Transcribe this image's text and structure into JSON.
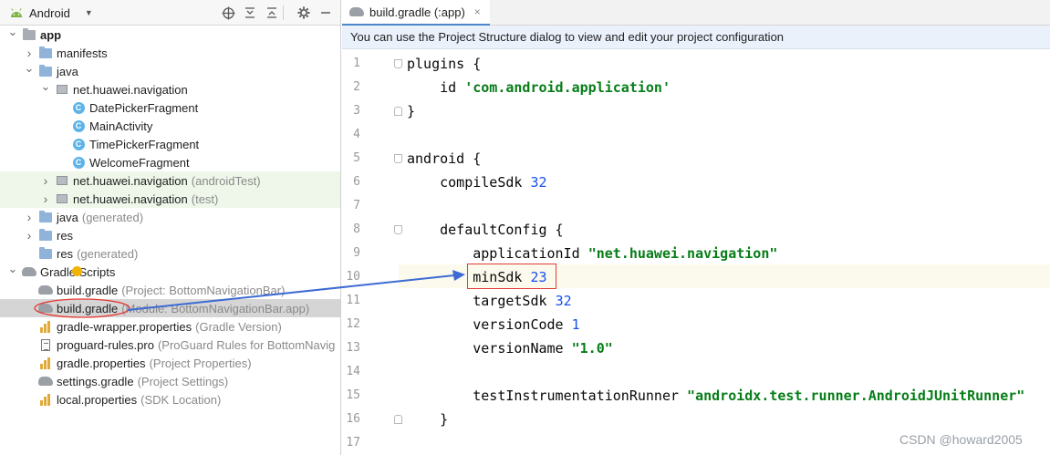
{
  "project_panel": {
    "view_selector": "Android",
    "header_icons": [
      "crosshair-icon",
      "collapse-all-icon",
      "expand-all-icon",
      "close-icon",
      "gear-icon",
      "minimize-icon"
    ],
    "tree": [
      {
        "name": "app",
        "hint": "",
        "icon": "module-folder"
      },
      {
        "name": "manifests",
        "hint": "",
        "icon": "folder"
      },
      {
        "name": "java",
        "hint": "",
        "icon": "folder"
      },
      {
        "name": "net.huawei.navigation",
        "hint": "",
        "icon": "package"
      },
      {
        "name": "DatePickerFragment",
        "hint": "",
        "icon": "class"
      },
      {
        "name": "MainActivity",
        "hint": "",
        "icon": "class"
      },
      {
        "name": "TimePickerFragment",
        "hint": "",
        "icon": "class"
      },
      {
        "name": "WelcomeFragment",
        "hint": "",
        "icon": "class"
      },
      {
        "name": "net.huawei.navigation",
        "hint": "(androidTest)",
        "icon": "package"
      },
      {
        "name": "net.huawei.navigation",
        "hint": "(test)",
        "icon": "package"
      },
      {
        "name": "java",
        "hint": "(generated)",
        "icon": "folder"
      },
      {
        "name": "res",
        "hint": "",
        "icon": "folder"
      },
      {
        "name": "res",
        "hint": "(generated)",
        "icon": "folder"
      },
      {
        "name": "Gradle Scripts",
        "hint": "",
        "icon": "gradle"
      },
      {
        "name": "build.gradle",
        "hint": "(Project: BottomNavigationBar)",
        "icon": "gradle"
      },
      {
        "name": "build.gradle",
        "hint": "(Module: BottomNavigationBar.app)",
        "icon": "gradle"
      },
      {
        "name": "gradle-wrapper.properties",
        "hint": "(Gradle Version)",
        "icon": "properties"
      },
      {
        "name": "proguard-rules.pro",
        "hint": "(ProGuard Rules for BottomNavig",
        "icon": "file"
      },
      {
        "name": "gradle.properties",
        "hint": "(Project Properties)",
        "icon": "properties"
      },
      {
        "name": "settings.gradle",
        "hint": "(Project Settings)",
        "icon": "gradle"
      },
      {
        "name": "local.properties",
        "hint": "(SDK Location)",
        "icon": "properties"
      }
    ]
  },
  "editor": {
    "tab_label": "build.gradle (:app)",
    "tab_close": "×",
    "banner": "You can use the Project Structure dialog to view and edit your project configuration",
    "line_numbers": [
      "1",
      "2",
      "3",
      "4",
      "5",
      "6",
      "7",
      "8",
      "9",
      "10",
      "11",
      "12",
      "13",
      "14",
      "15",
      "16",
      "17"
    ],
    "lines": [
      {
        "plain": "plugins {"
      },
      {
        "plain": "    id ",
        "str": "'com.android.application'"
      },
      {
        "plain": "}"
      },
      {
        "plain": ""
      },
      {
        "plain": "android {"
      },
      {
        "plain": "    compileSdk ",
        "num": "32"
      },
      {
        "plain": ""
      },
      {
        "plain": "    defaultConfig {"
      },
      {
        "plain": "        applicationId ",
        "str": "\"net.huawei.navigation\""
      },
      {
        "plain": "        minSdk ",
        "num": "23"
      },
      {
        "plain": "        targetSdk ",
        "num": "32"
      },
      {
        "plain": "        versionCode ",
        "num": "1"
      },
      {
        "plain": "        versionName ",
        "str": "\"1.0\""
      },
      {
        "plain": ""
      },
      {
        "plain": "        testInstrumentationRunner ",
        "str": "\"androidx.test.runner.AndroidJUnitRunner\""
      },
      {
        "plain": "    }"
      },
      {
        "plain": ""
      }
    ]
  },
  "colors": {
    "annotation_red": "#e53935",
    "annotation_arrow": "#3d6bd4",
    "string": "#067d17",
    "number": "#1750eb"
  },
  "watermark": "CSDN @howard2005"
}
